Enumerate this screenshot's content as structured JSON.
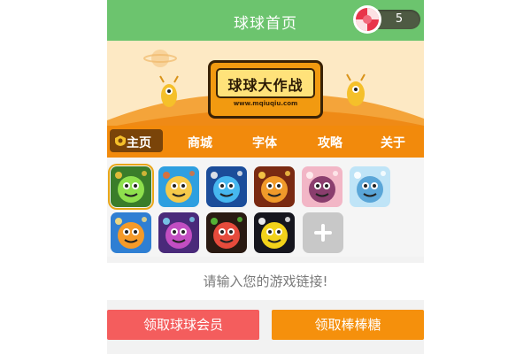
{
  "header": {
    "title": "球球首页",
    "coin_count": "5"
  },
  "banner": {
    "logo_title": "球球大作战",
    "logo_url": "www.mqiuqiu.com"
  },
  "nav": {
    "tabs": [
      {
        "label": "主页",
        "active": true
      },
      {
        "label": "商城"
      },
      {
        "label": "字体"
      },
      {
        "label": "攻略"
      },
      {
        "label": "关于"
      }
    ]
  },
  "games": [
    {
      "icon": "green-blob-game-icon",
      "colors": [
        "#3a7d2a",
        "#8ee04d",
        "#f2c23b"
      ],
      "selected": true
    },
    {
      "icon": "yellow-character-game-icon",
      "colors": [
        "#2e9fe0",
        "#f5c94a",
        "#e86b2e"
      ]
    },
    {
      "icon": "blue-eye-game-icon",
      "colors": [
        "#1b4d9a",
        "#46b7ef",
        "#f0f0f0"
      ]
    },
    {
      "icon": "fire-dragon-game-icon",
      "colors": [
        "#7a2a12",
        "#f09a2a",
        "#ffd24a"
      ]
    },
    {
      "icon": "anime-girl-game-icon",
      "colors": [
        "#f2b6c6",
        "#8a3e6e",
        "#fff0f0"
      ]
    },
    {
      "icon": "blue-hair-girl-game-icon",
      "colors": [
        "#bfe4f7",
        "#5aa6d8",
        "#ffffff"
      ]
    },
    {
      "icon": "orange-monster-game-icon",
      "colors": [
        "#2f7fd3",
        "#f59a28",
        "#ffe07a"
      ]
    },
    {
      "icon": "purple-monster-game-icon",
      "colors": [
        "#4a2a7a",
        "#c24ec2",
        "#7cd2f0"
      ]
    },
    {
      "icon": "colorful-balls-game-icon",
      "colors": [
        "#2a1a12",
        "#e64b3c",
        "#58c23a"
      ]
    },
    {
      "icon": "yellow-ball-game-icon",
      "colors": [
        "#16161e",
        "#f2d21a",
        "#ffffff"
      ]
    }
  ],
  "input": {
    "placeholder": "请输入您的游戏链接!"
  },
  "buttons": {
    "vip_label": "领取球球会员",
    "candy_label": "领取棒棒糖"
  }
}
